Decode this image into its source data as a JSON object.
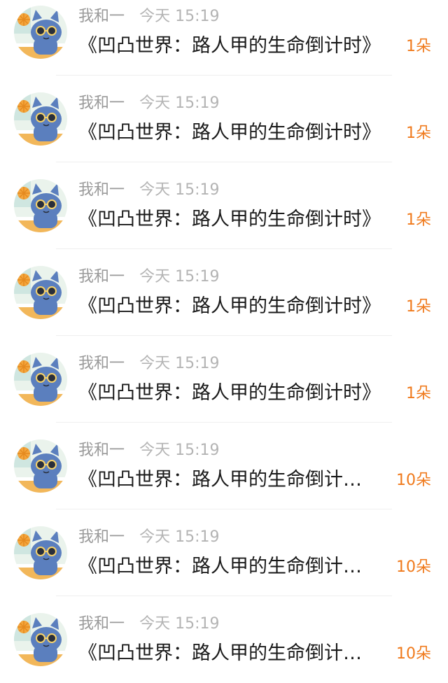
{
  "messages": [
    {
      "user": "我和一",
      "time": "今天 15:19",
      "title": "《凹凸世界：路人甲的生命倒计时》",
      "count": "1朵"
    },
    {
      "user": "我和一",
      "time": "今天 15:19",
      "title": "《凹凸世界：路人甲的生命倒计时》",
      "count": "1朵"
    },
    {
      "user": "我和一",
      "time": "今天 15:19",
      "title": "《凹凸世界：路人甲的生命倒计时》",
      "count": "1朵"
    },
    {
      "user": "我和一",
      "time": "今天 15:19",
      "title": "《凹凸世界：路人甲的生命倒计时》",
      "count": "1朵"
    },
    {
      "user": "我和一",
      "time": "今天 15:19",
      "title": "《凹凸世界：路人甲的生命倒计时》",
      "count": "1朵"
    },
    {
      "user": "我和一",
      "time": "今天 15:19",
      "title": "《凹凸世界：路人甲的生命倒计时》",
      "count": "10朵"
    },
    {
      "user": "我和一",
      "time": "今天 15:19",
      "title": "《凹凸世界：路人甲的生命倒计时》",
      "count": "10朵"
    },
    {
      "user": "我和一",
      "time": "今天 15:19",
      "title": "《凹凸世界：路人甲的生命倒计时》",
      "count": "10朵"
    }
  ],
  "colors": {
    "count": "#f07a1c",
    "username": "#9a9a9a",
    "time": "#b4b4b4",
    "title": "#1a1a1a",
    "avatar_cat": "#5b7fbe"
  },
  "icons": {
    "avatar": "blue-cat-with-sunglasses-avatar"
  }
}
